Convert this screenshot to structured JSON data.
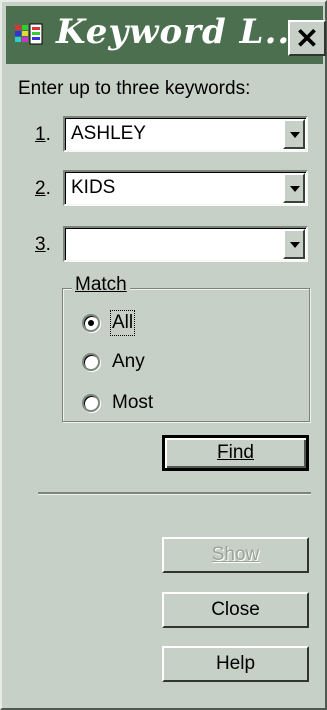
{
  "window": {
    "title": "Keyword L...",
    "close_label": "✕"
  },
  "instructions": "Enter up to three keywords:",
  "keywords": [
    {
      "number": "1",
      "value": "ASHLEY"
    },
    {
      "number": "2",
      "value": "KIDS"
    },
    {
      "number": "3",
      "value": ""
    }
  ],
  "match": {
    "title": "Match",
    "options": [
      {
        "label": "All",
        "selected": true
      },
      {
        "label": "Any",
        "selected": false
      },
      {
        "label": "Most",
        "selected": false
      }
    ]
  },
  "buttons": {
    "find": "Find",
    "show": "Show",
    "close": "Close",
    "help": "Help"
  },
  "colors": {
    "titlebar": "#4c6f4f",
    "face": "#c7d0c7"
  }
}
